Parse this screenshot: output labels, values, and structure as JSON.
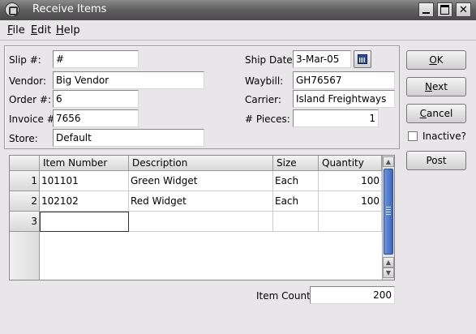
{
  "window": {
    "title": "Receive Items"
  },
  "menu": [
    {
      "label": "File",
      "mnemonic": "F",
      "rest": "ile"
    },
    {
      "label": "Edit",
      "mnemonic": "E",
      "rest": "dit"
    },
    {
      "label": "Help",
      "mnemonic": "H",
      "rest": "elp"
    }
  ],
  "form": {
    "slip_label": "Slip #:",
    "slip_value": "#",
    "vendor_label": "Vendor:",
    "vendor_value": "Big Vendor",
    "order_label": "Order #:",
    "order_value": "6",
    "invoice_label": "Invoice #:",
    "invoice_value": "7656",
    "store_label": "Store:",
    "store_value": "Default",
    "ship_date_label": "Ship Date:",
    "ship_date_value": "3-Mar-05",
    "waybill_label": "Waybill:",
    "waybill_value": "GH76567",
    "carrier_label": "Carrier:",
    "carrier_value": "Island Freightways",
    "pieces_label": "# Pieces:",
    "pieces_value": "1"
  },
  "buttons": {
    "ok": {
      "mn": "O",
      "rest": "K"
    },
    "next": {
      "mn": "N",
      "rest": "ext"
    },
    "cancel": {
      "mn": "C",
      "rest": "ancel"
    },
    "post": "Post",
    "inactive_label": "Inactive?"
  },
  "grid": {
    "columns": [
      "Item Number",
      "Description",
      "Size",
      "Quantity"
    ],
    "rows": [
      {
        "num": "1",
        "item": "101101",
        "desc": "Green Widget",
        "size": "Each",
        "qty": "100"
      },
      {
        "num": "2",
        "item": "102102",
        "desc": "Red Widget",
        "size": "Each",
        "qty": "100"
      },
      {
        "num": "3",
        "item": "",
        "desc": "",
        "size": "",
        "qty": ""
      }
    ]
  },
  "footer": {
    "item_count_label": "Item Count:",
    "item_count_value": "200"
  },
  "colors": {
    "titlebar": "#5e5e5e",
    "scroll_thumb": "#3a67c4",
    "background": "#e8e6e8"
  }
}
